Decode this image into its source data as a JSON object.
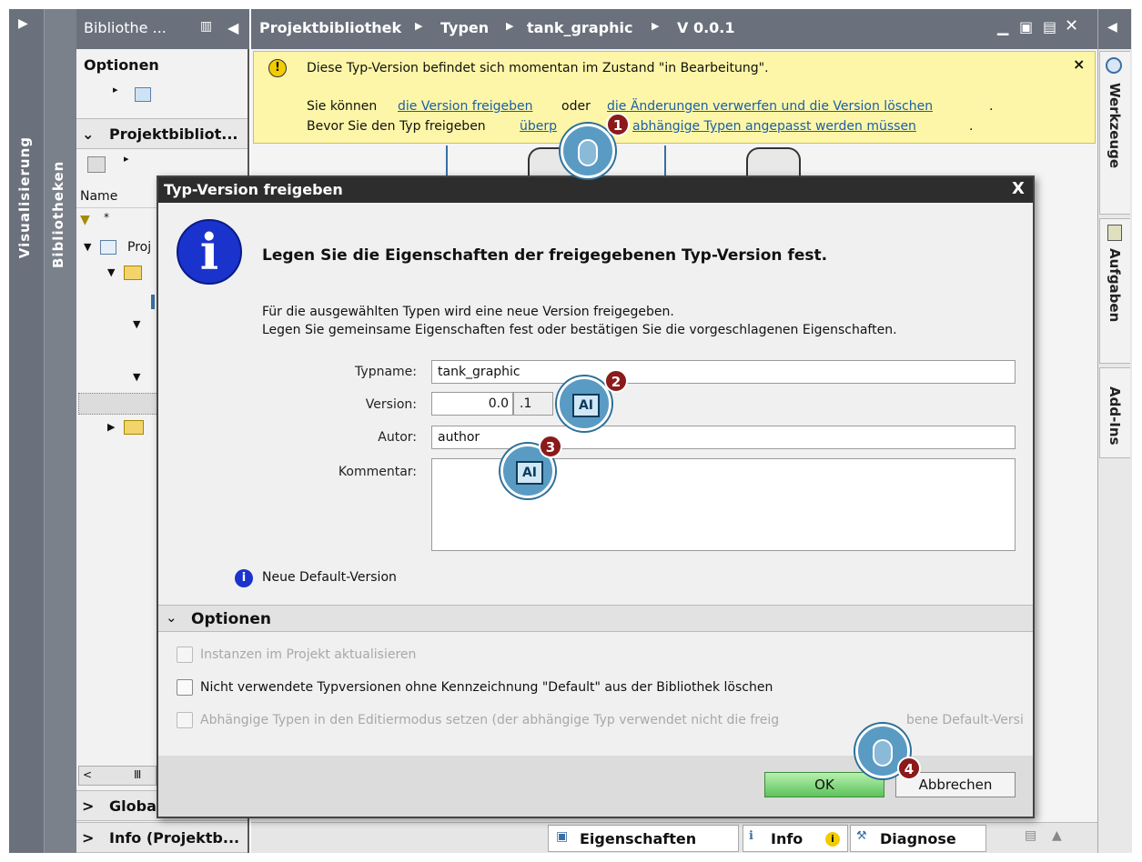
{
  "sidebar_left": {
    "visualisierung": "Visualisierung",
    "bibliotheken": "Bibliotheken"
  },
  "library_panel": {
    "title": "Bibliothe ...",
    "options": "Optionen",
    "project_library": "Projektbibliot...",
    "column_name": "Name",
    "filter_star": "*",
    "tree_root": "Proj",
    "global": "Globa",
    "info": "Info (Projektb..."
  },
  "breadcrumb": [
    "Projektbibliothek",
    "Typen",
    "tank_graphic",
    "V 0.0.1"
  ],
  "warning": {
    "line1": "Diese Typ-Version befindet sich momentan im Zustand \"in Bearbeitung\".",
    "line2_prefix": "Sie können",
    "link_release": "die Version freigeben",
    "line2_mid": "oder",
    "link_discard": "die Änderungen verwerfen und die Version löschen",
    "line2_end": ".",
    "line3_prefix": "Bevor Sie den Typ freigeben",
    "link_check": "überp",
    "link_dependent": "abhängige Typen angepasst werden müssen",
    "line3_end": ".",
    "close": "×"
  },
  "dialog": {
    "title": "Typ-Version freigeben",
    "close": "X",
    "heading": "Legen Sie die Eigenschaften der freigegebenen Typ-Version fest.",
    "desc1": "Für die ausgewählten Typen wird eine neue Version freigegeben.",
    "desc2": "Legen Sie gemeinsame Eigenschaften fest oder bestätigen Sie die vorgeschlagenen Eigenschaften.",
    "typname_label": "Typname:",
    "typname_value": "tank_graphic",
    "version_label": "Version:",
    "version_major": "0.0",
    "version_minor": ".1",
    "author_label": "Autor:",
    "author_value": "author",
    "comment_label": "Kommentar:",
    "default_note": "Neue Default-Version",
    "options_title": "Optionen",
    "opt1": "Instanzen im Projekt aktualisieren",
    "opt2": "Nicht verwendete Typversionen ohne Kennzeichnung \"Default\" aus der Bibliothek löschen",
    "opt3": "Abhängige Typen in den Editiermodus setzen (der abhängige Typ verwendet nicht die freig",
    "opt3_tail": "bene Default-Versi",
    "ok": "OK",
    "cancel": "Abbrechen"
  },
  "right_tabs": {
    "tools": "Werkzeuge",
    "tasks": "Aufgaben",
    "addins": "Add-Ins"
  },
  "bottom_bar": {
    "properties": "Eigenschaften",
    "info": "Info",
    "diagnose": "Diagnose"
  },
  "callouts": [
    "1",
    "2",
    "3",
    "4"
  ]
}
